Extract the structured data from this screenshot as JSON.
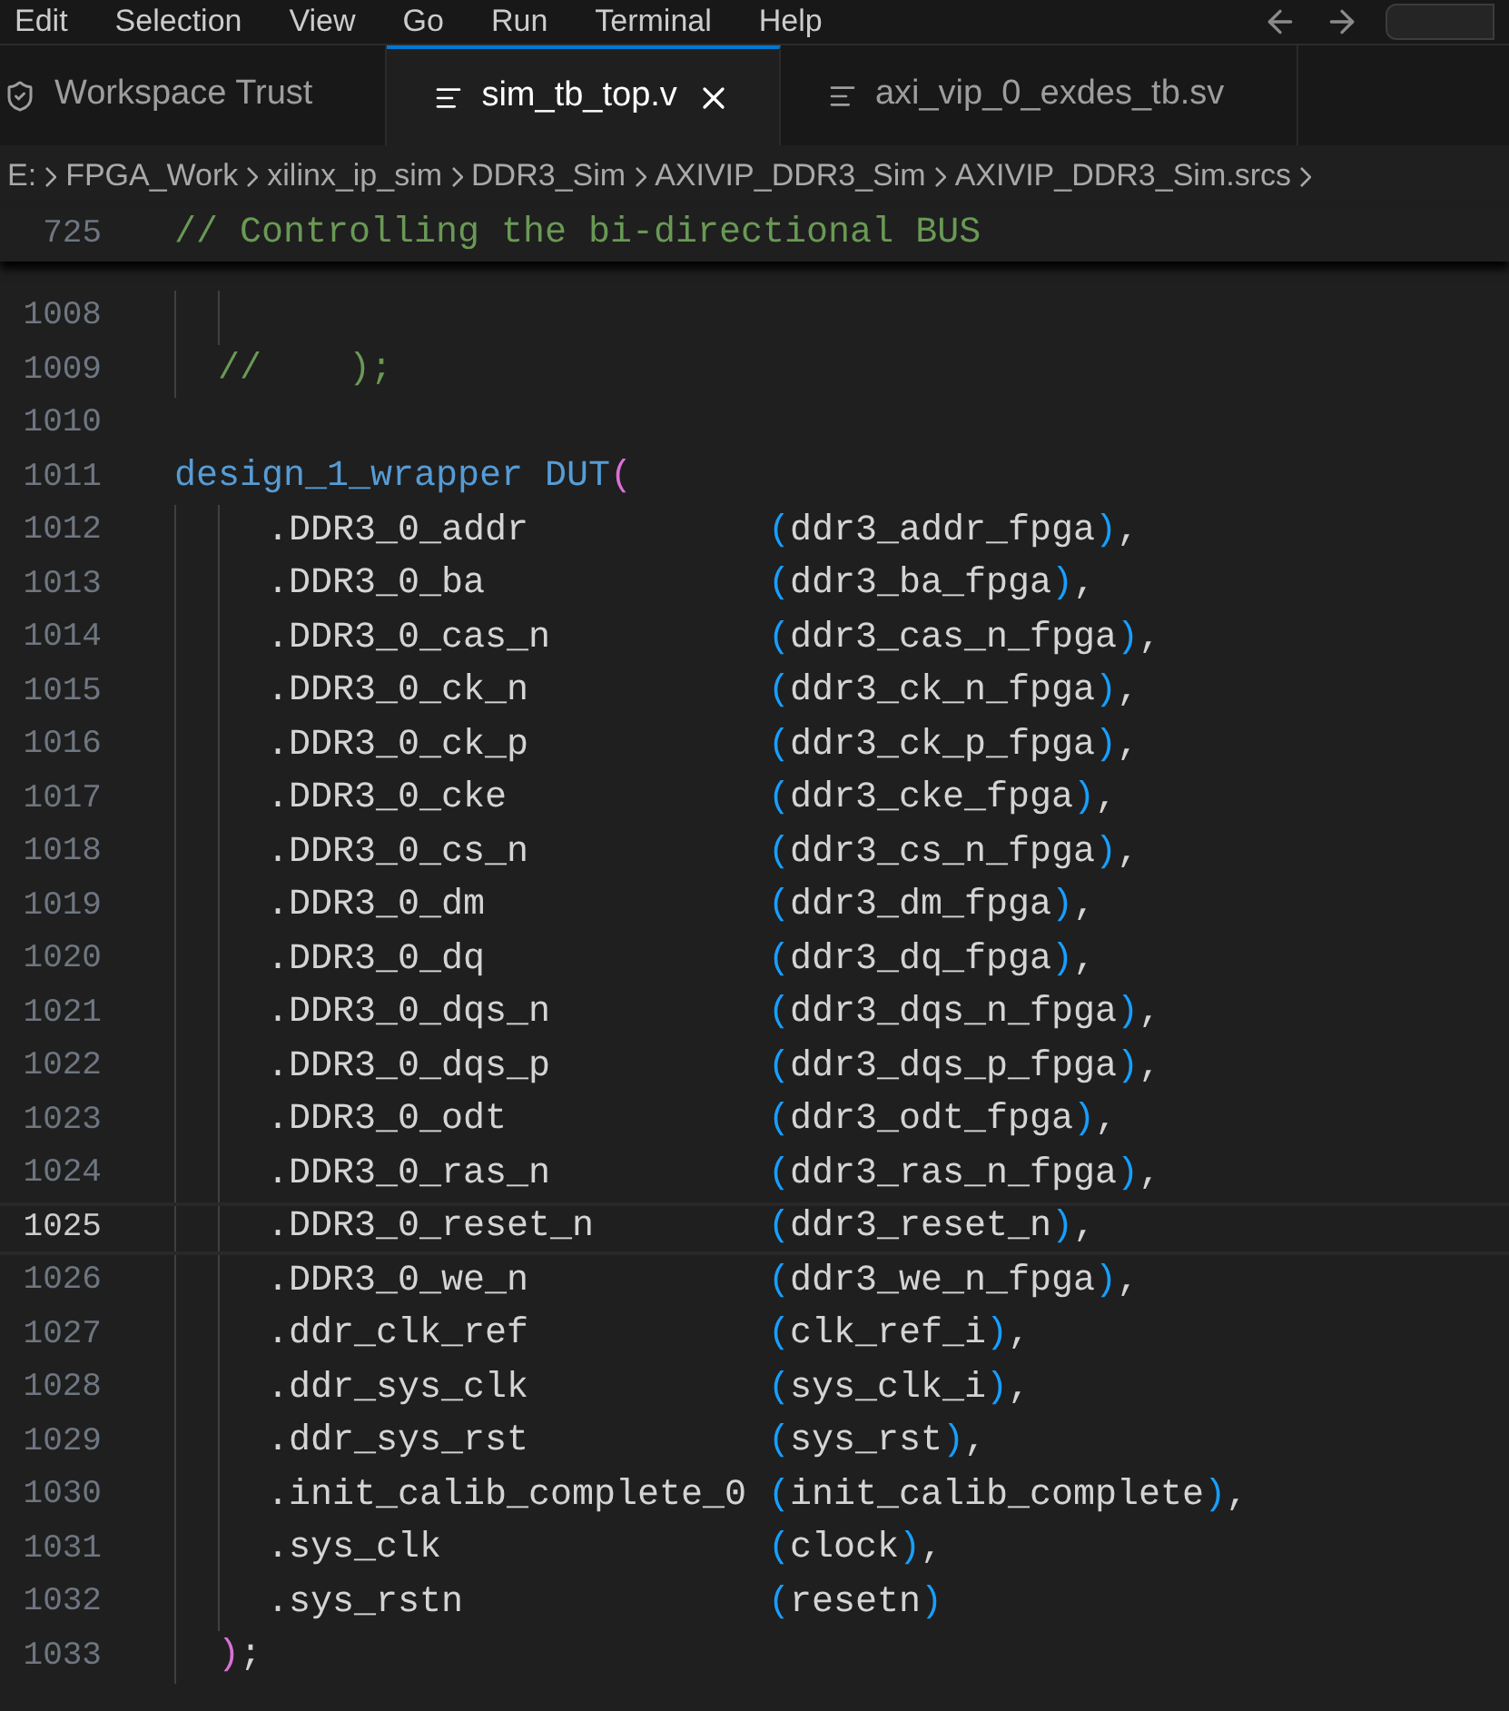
{
  "menu": [
    "Edit",
    "Selection",
    "View",
    "Go",
    "Run",
    "Terminal",
    "Help"
  ],
  "tabs": [
    {
      "label": "Workspace Trust",
      "kind": "trust",
      "selected": false
    },
    {
      "label": "sim_tb_top.v",
      "kind": "file",
      "selected": true
    },
    {
      "label": "axi_vip_0_exdes_tb.sv",
      "kind": "file",
      "selected": false
    }
  ],
  "breadcrumbs": [
    "E:",
    "FPGA_Work",
    "xilinx_ip_sim",
    "DDR3_Sim",
    "AXIVIP_DDR3_Sim",
    "AXIVIP_DDR3_Sim.srcs"
  ],
  "sticky_line": {
    "number": "725",
    "segments": [
      {
        "kind": "comment",
        "text": "// Controlling the bi-directional BUS"
      }
    ]
  },
  "lines": [
    {
      "number": "1008",
      "kind": "spacer",
      "selected": false
    },
    {
      "number": "1009",
      "kind": "comment",
      "selected": false,
      "segments": [
        {
          "kind": "comment",
          "text": "//    );"
        }
      ]
    },
    {
      "number": "1010",
      "kind": "blank",
      "selected": false
    },
    {
      "number": "1011",
      "kind": "module",
      "selected": false,
      "segments": [
        {
          "kind": "keyword",
          "text": "design_1_wrapper DUT"
        },
        {
          "kind": "paren2",
          "text": "("
        }
      ]
    },
    {
      "number": "1012",
      "kind": "port",
      "selected": false,
      "segments": [
        {
          "kind": "port",
          "text": ".DDR3_0_addr"
        },
        {
          "kind": "paren",
          "text": "("
        },
        {
          "kind": "plain",
          "text": "ddr3_addr_fpga"
        },
        {
          "kind": "paren",
          "text": ")"
        },
        {
          "kind": "plain",
          "text": ","
        }
      ]
    },
    {
      "number": "1013",
      "kind": "port",
      "selected": false,
      "segments": [
        {
          "kind": "port",
          "text": ".DDR3_0_ba"
        },
        {
          "kind": "paren",
          "text": "("
        },
        {
          "kind": "plain",
          "text": "ddr3_ba_fpga"
        },
        {
          "kind": "paren",
          "text": ")"
        },
        {
          "kind": "plain",
          "text": ","
        }
      ]
    },
    {
      "number": "1014",
      "kind": "port",
      "selected": false,
      "segments": [
        {
          "kind": "port",
          "text": ".DDR3_0_cas_n"
        },
        {
          "kind": "paren",
          "text": "("
        },
        {
          "kind": "plain",
          "text": "ddr3_cas_n_fpga"
        },
        {
          "kind": "paren",
          "text": ")"
        },
        {
          "kind": "plain",
          "text": ","
        }
      ]
    },
    {
      "number": "1015",
      "kind": "port",
      "selected": false,
      "segments": [
        {
          "kind": "port",
          "text": ".DDR3_0_ck_n"
        },
        {
          "kind": "paren",
          "text": "("
        },
        {
          "kind": "plain",
          "text": "ddr3_ck_n_fpga"
        },
        {
          "kind": "paren",
          "text": ")"
        },
        {
          "kind": "plain",
          "text": ","
        }
      ]
    },
    {
      "number": "1016",
      "kind": "port",
      "selected": false,
      "segments": [
        {
          "kind": "port",
          "text": ".DDR3_0_ck_p"
        },
        {
          "kind": "paren",
          "text": "("
        },
        {
          "kind": "plain",
          "text": "ddr3_ck_p_fpga"
        },
        {
          "kind": "paren",
          "text": ")"
        },
        {
          "kind": "plain",
          "text": ","
        }
      ]
    },
    {
      "number": "1017",
      "kind": "port",
      "selected": false,
      "segments": [
        {
          "kind": "port",
          "text": ".DDR3_0_cke"
        },
        {
          "kind": "paren",
          "text": "("
        },
        {
          "kind": "plain",
          "text": "ddr3_cke_fpga"
        },
        {
          "kind": "paren",
          "text": ")"
        },
        {
          "kind": "plain",
          "text": ","
        }
      ]
    },
    {
      "number": "1018",
      "kind": "port",
      "selected": false,
      "segments": [
        {
          "kind": "port",
          "text": ".DDR3_0_cs_n"
        },
        {
          "kind": "paren",
          "text": "("
        },
        {
          "kind": "plain",
          "text": "ddr3_cs_n_fpga"
        },
        {
          "kind": "paren",
          "text": ")"
        },
        {
          "kind": "plain",
          "text": ","
        }
      ]
    },
    {
      "number": "1019",
      "kind": "port",
      "selected": false,
      "segments": [
        {
          "kind": "port",
          "text": ".DDR3_0_dm"
        },
        {
          "kind": "paren",
          "text": "("
        },
        {
          "kind": "plain",
          "text": "ddr3_dm_fpga"
        },
        {
          "kind": "paren",
          "text": ")"
        },
        {
          "kind": "plain",
          "text": ","
        }
      ]
    },
    {
      "number": "1020",
      "kind": "port",
      "selected": false,
      "segments": [
        {
          "kind": "port",
          "text": ".DDR3_0_dq"
        },
        {
          "kind": "paren",
          "text": "("
        },
        {
          "kind": "plain",
          "text": "ddr3_dq_fpga"
        },
        {
          "kind": "paren",
          "text": ")"
        },
        {
          "kind": "plain",
          "text": ","
        }
      ]
    },
    {
      "number": "1021",
      "kind": "port",
      "selected": false,
      "segments": [
        {
          "kind": "port",
          "text": ".DDR3_0_dqs_n"
        },
        {
          "kind": "paren",
          "text": "("
        },
        {
          "kind": "plain",
          "text": "ddr3_dqs_n_fpga"
        },
        {
          "kind": "paren",
          "text": ")"
        },
        {
          "kind": "plain",
          "text": ","
        }
      ]
    },
    {
      "number": "1022",
      "kind": "port",
      "selected": false,
      "segments": [
        {
          "kind": "port",
          "text": ".DDR3_0_dqs_p"
        },
        {
          "kind": "paren",
          "text": "("
        },
        {
          "kind": "plain",
          "text": "ddr3_dqs_p_fpga"
        },
        {
          "kind": "paren",
          "text": ")"
        },
        {
          "kind": "plain",
          "text": ","
        }
      ]
    },
    {
      "number": "1023",
      "kind": "port",
      "selected": false,
      "segments": [
        {
          "kind": "port",
          "text": ".DDR3_0_odt"
        },
        {
          "kind": "paren",
          "text": "("
        },
        {
          "kind": "plain",
          "text": "ddr3_odt_fpga"
        },
        {
          "kind": "paren",
          "text": ")"
        },
        {
          "kind": "plain",
          "text": ","
        }
      ]
    },
    {
      "number": "1024",
      "kind": "port",
      "selected": false,
      "segments": [
        {
          "kind": "port",
          "text": ".DDR3_0_ras_n"
        },
        {
          "kind": "paren",
          "text": "("
        },
        {
          "kind": "plain",
          "text": "ddr3_ras_n_fpga"
        },
        {
          "kind": "paren",
          "text": ")"
        },
        {
          "kind": "plain",
          "text": ","
        }
      ]
    },
    {
      "number": "1025",
      "kind": "port",
      "selected": true,
      "segments": [
        {
          "kind": "port",
          "text": ".DDR3_0_reset_n"
        },
        {
          "kind": "paren",
          "text": "("
        },
        {
          "kind": "plain",
          "text": "ddr3_reset_n"
        },
        {
          "kind": "paren",
          "text": ")"
        },
        {
          "kind": "plain",
          "text": ","
        }
      ]
    },
    {
      "number": "1026",
      "kind": "port",
      "selected": false,
      "segments": [
        {
          "kind": "port",
          "text": ".DDR3_0_we_n"
        },
        {
          "kind": "paren",
          "text": "("
        },
        {
          "kind": "plain",
          "text": "ddr3_we_n_fpga"
        },
        {
          "kind": "paren",
          "text": ")"
        },
        {
          "kind": "plain",
          "text": ","
        }
      ]
    },
    {
      "number": "1027",
      "kind": "port",
      "selected": false,
      "segments": [
        {
          "kind": "port",
          "text": ".ddr_clk_ref"
        },
        {
          "kind": "paren",
          "text": "("
        },
        {
          "kind": "plain",
          "text": "clk_ref_i"
        },
        {
          "kind": "paren",
          "text": ")"
        },
        {
          "kind": "plain",
          "text": ","
        }
      ]
    },
    {
      "number": "1028",
      "kind": "port",
      "selected": false,
      "segments": [
        {
          "kind": "port",
          "text": ".ddr_sys_clk"
        },
        {
          "kind": "paren",
          "text": "("
        },
        {
          "kind": "plain",
          "text": "sys_clk_i"
        },
        {
          "kind": "paren",
          "text": ")"
        },
        {
          "kind": "plain",
          "text": ","
        }
      ]
    },
    {
      "number": "1029",
      "kind": "port",
      "selected": false,
      "segments": [
        {
          "kind": "port",
          "text": ".ddr_sys_rst"
        },
        {
          "kind": "paren",
          "text": "("
        },
        {
          "kind": "plain",
          "text": "sys_rst"
        },
        {
          "kind": "paren",
          "text": ")"
        },
        {
          "kind": "plain",
          "text": ","
        }
      ]
    },
    {
      "number": "1030",
      "kind": "port",
      "selected": false,
      "segments": [
        {
          "kind": "port",
          "text": ".init_calib_complete_0"
        },
        {
          "kind": "paren",
          "text": "("
        },
        {
          "kind": "plain",
          "text": "init_calib_complete"
        },
        {
          "kind": "paren",
          "text": ")"
        },
        {
          "kind": "plain",
          "text": ","
        }
      ]
    },
    {
      "number": "1031",
      "kind": "port",
      "selected": false,
      "segments": [
        {
          "kind": "port",
          "text": ".sys_clk"
        },
        {
          "kind": "paren",
          "text": "("
        },
        {
          "kind": "plain",
          "text": "clock"
        },
        {
          "kind": "paren",
          "text": ")"
        },
        {
          "kind": "plain",
          "text": ","
        }
      ]
    },
    {
      "number": "1032",
      "kind": "port",
      "selected": false,
      "segments": [
        {
          "kind": "port",
          "text": ".sys_rstn"
        },
        {
          "kind": "paren",
          "text": "("
        },
        {
          "kind": "plain",
          "text": "resetn"
        },
        {
          "kind": "paren",
          "text": ")"
        }
      ]
    },
    {
      "number": "1033",
      "kind": "close",
      "selected": false,
      "segments": [
        {
          "kind": "paren2",
          "text": ")"
        },
        {
          "kind": "plain",
          "text": ";"
        }
      ]
    }
  ]
}
